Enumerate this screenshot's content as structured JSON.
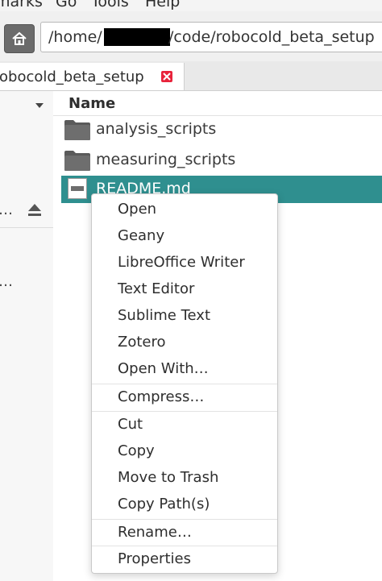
{
  "menubar": {
    "bookmarks": "marks",
    "go": "Go",
    "tools": "Tools",
    "help": "Help"
  },
  "path": {
    "prefix": "/home/",
    "suffix": "/code/robocold_beta_setup"
  },
  "tab": {
    "label": "robocold_beta_setup"
  },
  "sidebar": {
    "ellipsis1": "…",
    "ellipsis2": "…"
  },
  "list": {
    "header_name": "Name",
    "rows": [
      {
        "name": "analysis_scripts"
      },
      {
        "name": "measuring_scripts"
      },
      {
        "name": "README.md"
      }
    ]
  },
  "context_menu": {
    "items": [
      "Open",
      "Geany",
      "LibreOffice Writer",
      "Text Editor",
      "Sublime Text",
      "Zotero",
      "Open With…",
      "Compress…",
      "Cut",
      "Copy",
      "Move to Trash",
      "Copy Path(s)",
      "Rename…",
      "Properties"
    ]
  },
  "colors": {
    "selection": "#2f8f8f",
    "tab_close": "#e8233b"
  }
}
